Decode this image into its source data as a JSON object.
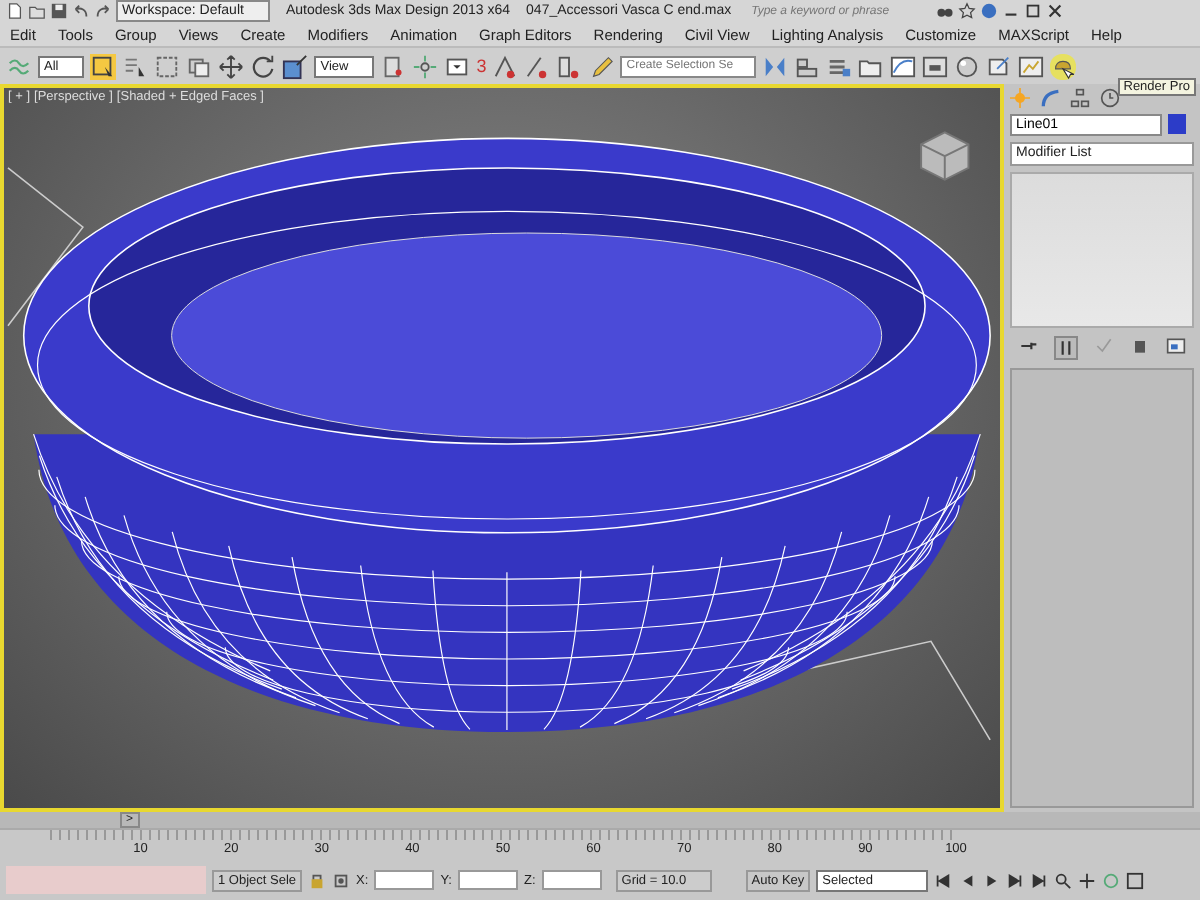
{
  "title_bar": {
    "workspace": "Workspace: Default",
    "title": "Autodesk 3ds Max Design 2013 x64",
    "file": "047_Accessori Vasca C end.max",
    "search": {
      "placeholder": "Type a keyword or phrase"
    }
  },
  "menu": [
    "Edit",
    "Tools",
    "Group",
    "Views",
    "Create",
    "Modifiers",
    "Animation",
    "Graph Editors",
    "Rendering",
    "Civil View",
    "Lighting Analysis",
    "Customize",
    "MAXScript",
    "Help"
  ],
  "toolbar": {
    "selection_filter": "All",
    "reference_coord": "View",
    "snap_label": "3",
    "named_selection": {
      "placeholder": "Create Selection Se"
    },
    "tooltip": "Render Pro"
  },
  "viewport": {
    "labels": [
      "[ + ]",
      "[Perspective ]",
      "[Shaded + Edged Faces ]"
    ]
  },
  "command_panel": {
    "object": {
      "name": "Line01",
      "color": "#2c3cc8"
    },
    "modifier_list": "Modifier List"
  },
  "timeline": {
    "slider_button": ">",
    "ticks": [
      "10",
      "20",
      "30",
      "40",
      "50",
      "60",
      "70",
      "80",
      "90",
      "100"
    ]
  },
  "status_bar": {
    "selection": "1 Object Sele",
    "x_label": "X:",
    "y_label": "Y:",
    "z_label": "Z:",
    "grid": "Grid = 10.0",
    "auto_key": "Auto Key",
    "key_filter": "Selected"
  }
}
